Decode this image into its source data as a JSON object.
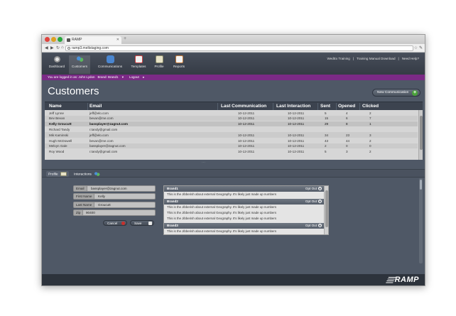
{
  "browser": {
    "tab_title": "RAMP",
    "url": "ramp3.meltstaging.com"
  },
  "nav": {
    "items": [
      {
        "label": "Dashboard",
        "icon": "gear-icon"
      },
      {
        "label": "Customers",
        "icon": "users-icon"
      },
      {
        "label": "Communications",
        "icon": "chat-icon"
      },
      {
        "label": "Templates",
        "icon": "template-icon"
      },
      {
        "label": "Profile",
        "icon": "profile-card-icon"
      },
      {
        "label": "Reports",
        "icon": "clipboard-icon"
      }
    ],
    "toplinks": [
      "WedEx Training",
      "|",
      "Training Manual Download",
      "|",
      "Need Help?"
    ]
  },
  "userbar": {
    "logged_in": "You are logged in as: John Lydon",
    "brand": "Brand: Brand1",
    "logout": "Logout"
  },
  "page": {
    "title": "Customers",
    "new_button": "New Communication"
  },
  "table": {
    "headers": [
      "Name",
      "Email",
      "Last Communication",
      "Last Interaction",
      "Sent",
      "Opened",
      "Clicked"
    ],
    "rows": [
      {
        "name": "Jeff Lynne",
        "email": "jeff@elo.com",
        "lc": "10-12-2011",
        "li": "10-12-2011",
        "sent": "5",
        "opened": "4",
        "clicked": "2"
      },
      {
        "name": "Bev Bevan",
        "email": "bevan@me.com",
        "lc": "10-12-2011",
        "li": "10-12-2011",
        "sent": "15",
        "opened": "6",
        "clicked": "7"
      },
      {
        "name": "Kelly Groucutt",
        "email": "bassplayer@zagnut.com",
        "lc": "10-12-2011",
        "li": "10-12-2011",
        "sent": "29",
        "opened": "8",
        "clicked": "1"
      },
      {
        "name": "Richard Tandy",
        "email": "r.tandy@gmail.com",
        "lc": "",
        "li": "",
        "sent": "",
        "opened": "",
        "clicked": ""
      },
      {
        "name": "Mik Kaminski",
        "email": "jeff@elo.com",
        "lc": "10-12-2011",
        "li": "10-12-2011",
        "sent": "34",
        "opened": "23",
        "clicked": "3"
      },
      {
        "name": "Hugh McDowell",
        "email": "bevan@me.com",
        "lc": "10-12-2011",
        "li": "10-12-2011",
        "sent": "43",
        "opened": "44",
        "clicked": "2"
      },
      {
        "name": "Melvyn Gale",
        "email": "bassplayer@zagnut.com",
        "lc": "10-12-2011",
        "li": "10-12-2011",
        "sent": "2",
        "opened": "0",
        "clicked": "0"
      },
      {
        "name": "Roy Wood",
        "email": "r.tandy@gmail.com",
        "lc": "10-12-2011",
        "li": "10-12-2011",
        "sent": "5",
        "opened": "3",
        "clicked": "2"
      }
    ]
  },
  "lower_tabs": {
    "profile": "Profile",
    "interactions": "Interactions"
  },
  "form": {
    "email_label": "Email",
    "email_value": "bassplayer@zagnut.com",
    "first_label": "First Name",
    "first_value": "Kelly",
    "last_label": "Last Name",
    "last_value": "Groucutt",
    "zip_label": "Zip",
    "zip_value": "90400",
    "cancel": "Cancel",
    "save": "Save"
  },
  "brands": [
    {
      "name": "Brand1",
      "opt_out": "Opt Out",
      "lines": [
        "This is the Jibberish about external Geography. It's likely just made up numbers"
      ]
    },
    {
      "name": "Brand2",
      "opt_out": "Opt Out",
      "lines": [
        "This is the Jibberish about external Geography. It's likely just made up numbers",
        "This is the Jibberish about external Geography. It's likely just made up numbers",
        "This is the Jibberish about external Geography. It's likely just made up numbers"
      ]
    },
    {
      "name": "Brand3",
      "opt_out": "Opt Out",
      "lines": [
        "This is the Jibberish about external Geography. It's likely just made up numbers"
      ]
    }
  ],
  "footer": {
    "logo": "RAMP"
  },
  "colors": {
    "userbar": "#7b2a86",
    "app_bg": "#4f5866",
    "add_green": "#4aa33a",
    "cancel_red": "#c9302c"
  }
}
